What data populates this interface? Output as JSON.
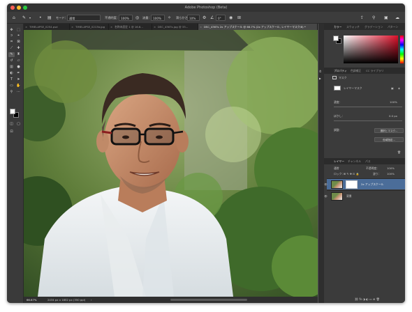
{
  "window": {
    "title": "Adobe Photoshop (Beta)"
  },
  "options_bar": {
    "mode_label": "モード：",
    "mode_value": "通常",
    "opacity_label": "不透明度：",
    "opacity_value": "100%",
    "flow_label": "流量：",
    "flow_value": "100%",
    "smoothing_label": "滑らかさ：",
    "smoothing_value": "10%",
    "angle_value": "0°"
  },
  "doc_tabs": [
    "TIMELAPSE_0254.psd",
    "TIMELAPSE_0213b.jpg",
    "名称未設定 1 @ 16.6...",
    "DSC_4367s.jpg @ 33...",
    "DSC_4367s 2x アップスケール @ 66.7% (2x アップスケール, レイヤーマスク/8) *"
  ],
  "status_bar": {
    "zoom": "66.67%",
    "doc_info": "2434 px x 1852 px (350 ppi)"
  },
  "color_panel": {
    "tabs": [
      "カラー",
      "スウォッチ",
      "グラデーション",
      "パターン"
    ]
  },
  "properties_panel": {
    "tabs": [
      "プロパティ",
      "色調補正",
      "CC ライブラリ"
    ],
    "mask_section_label": "マスク",
    "layer_mask_label": "レイヤーマスク",
    "density_label": "濃度：",
    "density_value": "100%",
    "feather_label": "ぼかし：",
    "feather_value": "0.0 px",
    "refine_label": "調整：",
    "select_and_mask_button": "選択とマスク...",
    "color_range_button": "色域指定..."
  },
  "layers_panel": {
    "tabs": [
      "レイヤー",
      "チャンネル",
      "パス"
    ],
    "blend_mode": "通常",
    "opacity_label": "不透明度：",
    "opacity_value": "100%",
    "lock_label": "ロック：",
    "fill_label": "塗り：",
    "fill_value": "100%",
    "layers": [
      {
        "name": "2x アップスケール",
        "selected": true
      },
      {
        "name": "背景",
        "selected": false
      }
    ]
  },
  "colors": {
    "app_bg": "#535353",
    "panel_bg": "#3b3b3b",
    "accent": "#4b6d99"
  },
  "icons": [
    "home-icon",
    "brush-icon",
    "airbrush-icon",
    "pressure-icon",
    "symmetry-icon",
    "share-icon",
    "search-icon",
    "workspace-icon",
    "cloud-icon"
  ]
}
